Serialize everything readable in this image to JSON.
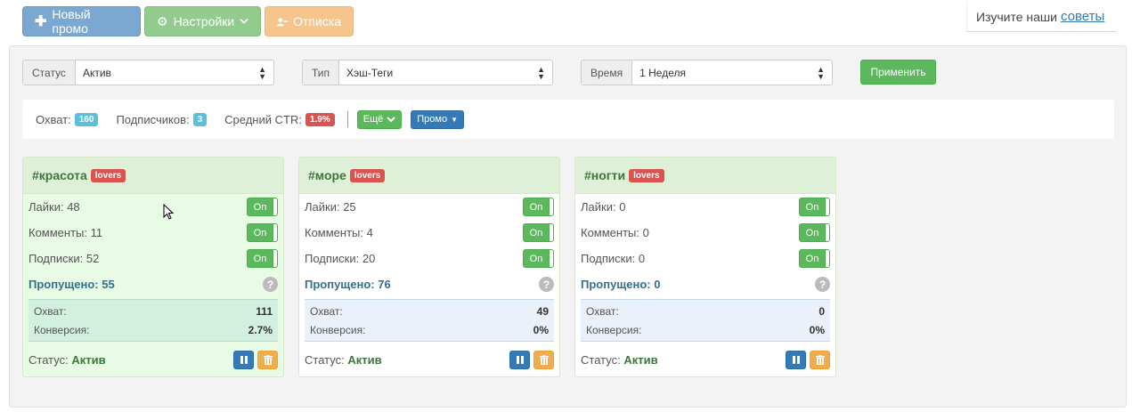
{
  "toolbar": {
    "new_promo": "Новый промо",
    "settings": "Настройки",
    "unsubscribe": "Отписка"
  },
  "tips": {
    "prefix": "Изучите наши",
    "link": "советы"
  },
  "filters": {
    "status": {
      "label": "Статус",
      "value": "Актив"
    },
    "type": {
      "label": "Тип",
      "value": "Хэш-Теги"
    },
    "time": {
      "label": "Время",
      "value": "1 Неделя"
    },
    "apply": "Применить"
  },
  "stats": {
    "reach_label": "Охват:",
    "reach_value": "160",
    "subs_label": "Подписчиков:",
    "subs_value": "3",
    "ctr_label": "Средний CTR:",
    "ctr_value": "1.9%",
    "more_button": "Ещё",
    "promo_button": "Промо"
  },
  "cards": [
    {
      "tag": "#красота",
      "badge": "lovers",
      "likes": "Лайки: 48",
      "comments": "Комменты: 11",
      "follows": "Подписки: 52",
      "toggle": "On",
      "skipped": "Пропущено: 55",
      "reach_label": "Охват:",
      "reach": "111",
      "conv_label": "Конверсия:",
      "conv": "2.7%",
      "status_label": "Статус:",
      "status": "Актив"
    },
    {
      "tag": "#море",
      "badge": "lovers",
      "likes": "Лайки: 25",
      "comments": "Комменты: 4",
      "follows": "Подписки: 20",
      "toggle": "On",
      "skipped": "Пропущено: 76",
      "reach_label": "Охват:",
      "reach": "49",
      "conv_label": "Конверсия:",
      "conv": "0%",
      "status_label": "Статус:",
      "status": "Актив"
    },
    {
      "tag": "#ногти",
      "badge": "lovers",
      "likes": "Лайки: 0",
      "comments": "Комменты: 0",
      "follows": "Подписки: 0",
      "toggle": "On",
      "skipped": "Пропущено: 0",
      "reach_label": "Охват:",
      "reach": "0",
      "conv_label": "Конверсия:",
      "conv": "0%",
      "status_label": "Статус:",
      "status": "Актив"
    }
  ],
  "colors": {
    "primary": "#337ab7",
    "success": "#5cb85c",
    "danger": "#d9534f",
    "warning": "#f0ad4e",
    "info": "#5bc0de"
  }
}
